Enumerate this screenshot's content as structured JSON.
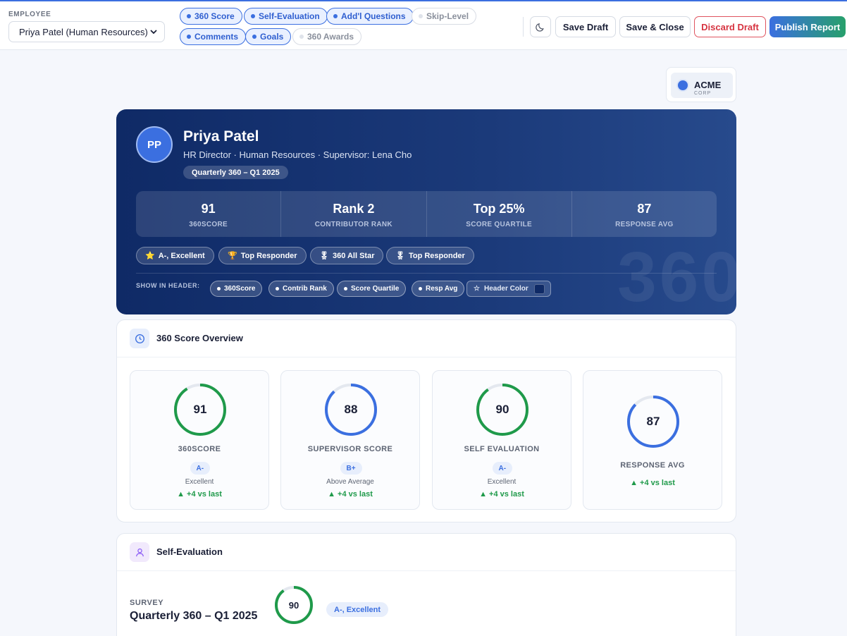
{
  "toolbar": {
    "employee_label": "EMPLOYEE",
    "employee_value": "Priya Patel (Human Resources)",
    "section_chips": [
      {
        "label": "360 Score",
        "active": true
      },
      {
        "label": "Self-Evaluation",
        "active": true
      },
      {
        "label": "Add'l Questions",
        "active": true
      },
      {
        "label": "Skip-Level",
        "active": false
      },
      {
        "label": "Comments",
        "active": true
      },
      {
        "label": "Goals",
        "active": true
      },
      {
        "label": "360 Awards",
        "active": false
      }
    ],
    "theme_icon": "moon-icon",
    "save_draft": "Save Draft",
    "save_close": "Save & Close",
    "discard_draft": "Discard Draft",
    "publish": "Publish Report"
  },
  "logo": {
    "name": "ACME",
    "sub": "CORP"
  },
  "hero": {
    "initials": "PP",
    "name": "Priya Patel",
    "subtitle": "HR Director · Human Resources · Supervisor: Lena Cho",
    "period": "Quarterly 360 – Q1 2025",
    "stats": [
      {
        "value": "91",
        "label": "360SCORE"
      },
      {
        "value": "Rank 2",
        "label": "CONTRIBUTOR RANK"
      },
      {
        "value": "Top 25%",
        "label": "SCORE QUARTILE"
      },
      {
        "value": "87",
        "label": "RESPONSE AVG"
      }
    ],
    "badges": [
      {
        "icon": "⭐",
        "label": "A-, Excellent"
      },
      {
        "icon": "🏆",
        "label": "Top Responder"
      },
      {
        "icon": "🎖",
        "label": "360 All Star"
      },
      {
        "icon": "🎖",
        "label": "Top Responder"
      }
    ],
    "show_in_header_label": "SHOW IN HEADER:",
    "header_toggles": [
      "360Score",
      "Contrib Rank",
      "Score Quartile",
      "Resp Avg"
    ],
    "header_color_label": "Header Color",
    "header_color": "#0f2a66",
    "watermark": "360"
  },
  "overview": {
    "title": "360 Score Overview",
    "cards": [
      {
        "value": 91,
        "label": "360SCORE",
        "grade": "A-",
        "desc": "Excellent",
        "delta": "▲ +4 vs last",
        "color": "#1f9a4a"
      },
      {
        "value": 88,
        "label": "SUPERVISOR SCORE",
        "grade": "B+",
        "desc": "Above Average",
        "delta": "▲ +4 vs last",
        "color": "#3b6fe0"
      },
      {
        "value": 90,
        "label": "SELF EVALUATION",
        "grade": "A-",
        "desc": "Excellent",
        "delta": "▲ +4 vs last",
        "color": "#1f9a4a"
      },
      {
        "value": 87,
        "label": "RESPONSE AVG",
        "grade": "",
        "desc": "",
        "delta": "▲ +4 vs last",
        "color": "#3b6fe0"
      }
    ]
  },
  "self_eval": {
    "title": "Self-Evaluation",
    "survey_label": "SURVEY",
    "survey_name": "Quarterly 360 – Q1 2025",
    "score": 90,
    "score_color": "#1f9a4a",
    "grade": "A-, Excellent"
  }
}
